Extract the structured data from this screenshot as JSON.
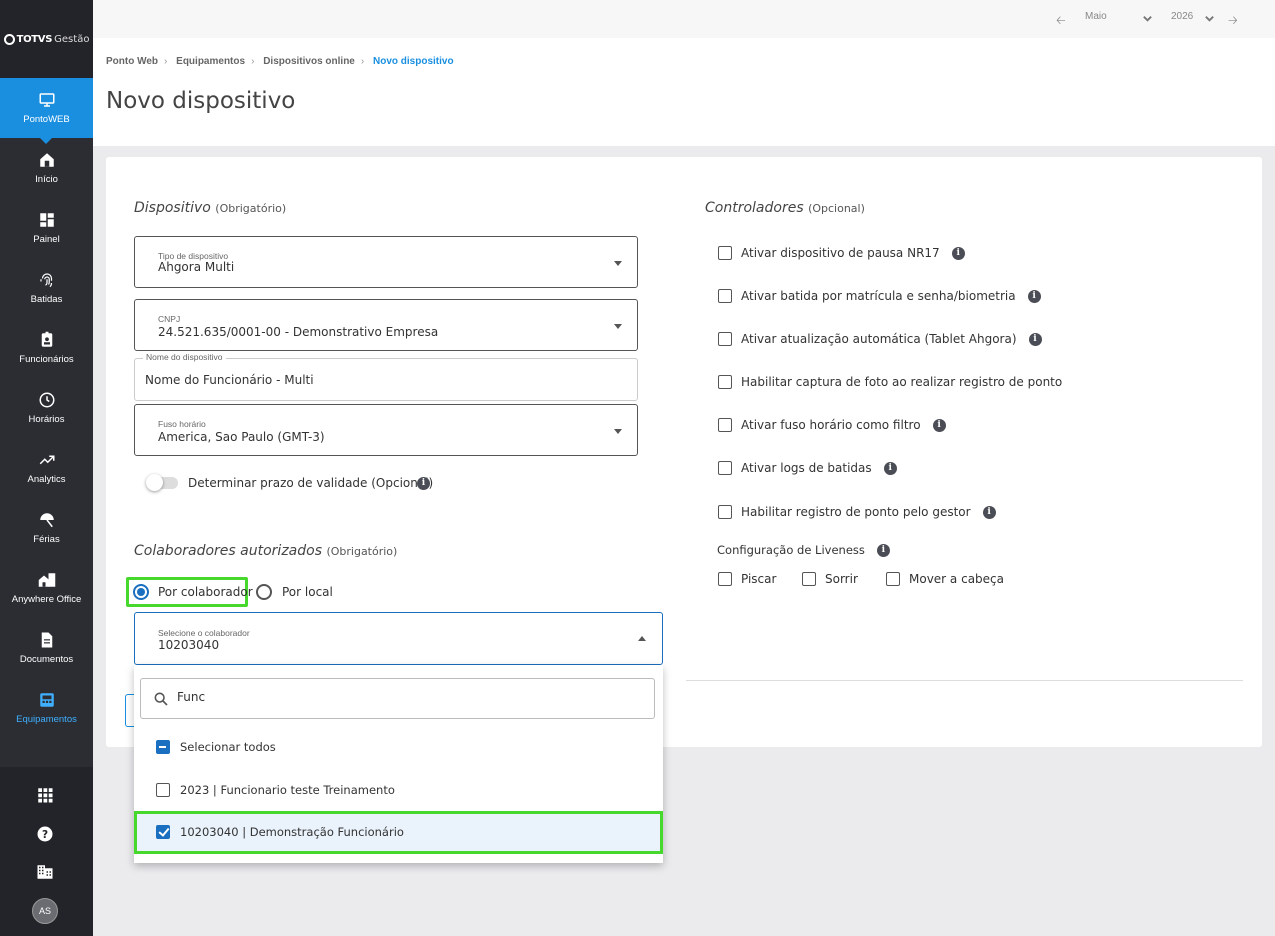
{
  "brand": {
    "name": "TOTVS",
    "suffix": "Gestão"
  },
  "sidebar": {
    "active_module": "PontoWEB",
    "items": [
      {
        "label": "Início",
        "icon": "home-icon"
      },
      {
        "label": "Painel",
        "icon": "dashboard-icon"
      },
      {
        "label": "Batidas",
        "icon": "fingerprint-icon"
      },
      {
        "label": "Funcionários",
        "icon": "badge-icon"
      },
      {
        "label": "Horários",
        "icon": "clock-icon"
      },
      {
        "label": "Analytics",
        "icon": "trending-icon"
      },
      {
        "label": "Férias",
        "icon": "umbrella-icon"
      },
      {
        "label": "Anywhere Office",
        "icon": "home-work-icon"
      },
      {
        "label": "Documentos",
        "icon": "document-icon"
      },
      {
        "label": "Equipamentos",
        "icon": "device-icon"
      }
    ],
    "avatar": "AS"
  },
  "topbar": {
    "month": "Maio",
    "year": "2026"
  },
  "breadcrumb": [
    "Ponto Web",
    "Equipamentos",
    "Dispositivos online",
    "Novo dispositivo"
  ],
  "page_title": "Novo dispositivo",
  "dispositivo": {
    "title": "Dispositivo",
    "note": "(Obrigatório)",
    "tipo_label": "Tipo de dispositivo",
    "tipo_value": "Ahgora Multi",
    "cnpj_label": "CNPJ",
    "cnpj_value": "24.521.635/0001-00 - Demonstrativo Empresa",
    "nome_label": "Nome do dispositivo",
    "nome_value": "Nome do Funcionário - Multi",
    "fuso_label": "Fuso horário",
    "fuso_value": "America, Sao Paulo (GMT-3)",
    "validade_label": "Determinar prazo de validade (Opcional)"
  },
  "colaboradores": {
    "title": "Colaboradores autorizados",
    "note": "(Obrigatório)",
    "radio_colaborador": "Por colaborador",
    "radio_local": "Por local",
    "select_label": "Selecione o colaborador",
    "select_value": "10203040",
    "search_value": "Func",
    "select_all": "Selecionar todos",
    "options": [
      {
        "label": "2023 | Funcionario teste Treinamento",
        "checked": false
      },
      {
        "label": "10203040 | Demonstração Funcionário",
        "checked": true
      }
    ]
  },
  "controladores": {
    "title": "Controladores",
    "note": "(Opcional)",
    "items": [
      "Ativar dispositivo de pausa NR17",
      "Ativar batida por matrícula e senha/biometria",
      "Ativar atualização automática (Tablet Ahgora)",
      "Habilitar captura de foto ao realizar registro de ponto",
      "Ativar fuso horário como filtro",
      "Ativar logs de batidas",
      "Habilitar registro de ponto pelo gestor"
    ],
    "liveness_label": "Configuração de Liveness",
    "liveness_options": [
      "Piscar",
      "Sorrir",
      "Mover a cabeça"
    ]
  },
  "colors": {
    "accent": "#1a8fe0",
    "highlight": "#46d82d",
    "sidebar": "#2b2d33"
  }
}
